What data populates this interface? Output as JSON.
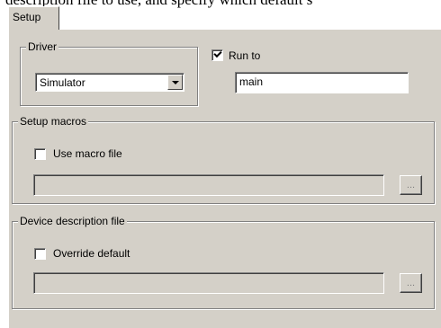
{
  "header_text": "description file to use, and specify which default s",
  "tab": {
    "label": "Setup"
  },
  "driver": {
    "group_label": "Driver",
    "selected": "Simulator"
  },
  "run_to": {
    "label": "Run to",
    "checked": true,
    "value": "main"
  },
  "setup_macros": {
    "group_label": "Setup macros",
    "checkbox_label": "Use macro file",
    "checked": false,
    "path": "",
    "browse_label": "..."
  },
  "device_description": {
    "group_label": "Device description file",
    "checkbox_label": "Override default",
    "checked": false,
    "path": "",
    "browse_label": "..."
  },
  "colors": {
    "panel": "#d4d0c8",
    "shadow": "#808080",
    "highlight": "#ffffff"
  }
}
